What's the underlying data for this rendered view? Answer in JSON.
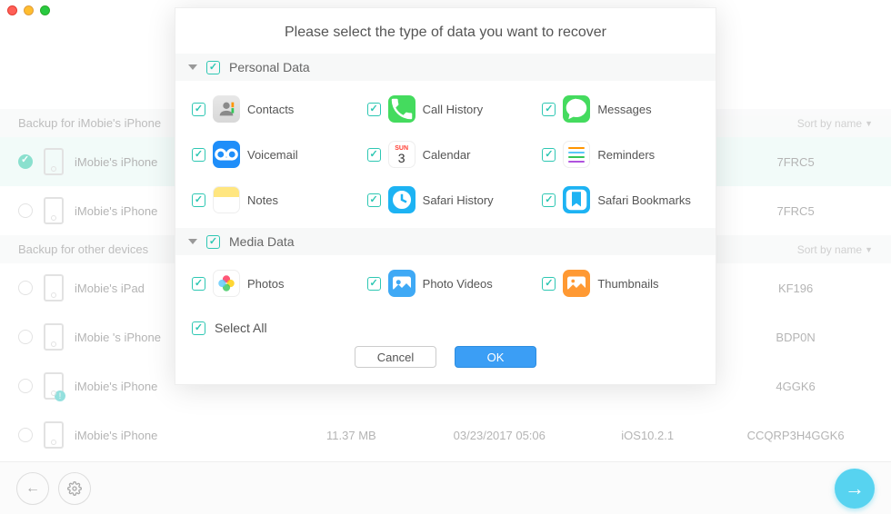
{
  "window": {
    "traffic": [
      "close",
      "minimize",
      "maximize"
    ]
  },
  "sort_label": "Sort by name",
  "sections": [
    {
      "title": "Backup for iMobie's iPhone"
    },
    {
      "title": "Backup for other devices"
    }
  ],
  "rows": [
    {
      "name": "iMobie's iPhone",
      "size": "",
      "date": "",
      "ios": "",
      "id": "7FRC5",
      "selected": true
    },
    {
      "name": "iMobie's iPhone",
      "size": "",
      "date": "",
      "ios": "",
      "id": "7FRC5",
      "selected": false
    },
    {
      "name": "iMobie's iPad",
      "size": "",
      "date": "",
      "ios": "",
      "id": "KF196",
      "selected": false
    },
    {
      "name": "iMobie 's iPhone",
      "size": "",
      "date": "",
      "ios": "",
      "id": "BDP0N",
      "selected": false
    },
    {
      "name": "iMobie's iPhone",
      "size": "",
      "date": "",
      "ios": "",
      "id": "4GGK6",
      "selected": false,
      "warn": true
    },
    {
      "name": "iMobie's iPhone",
      "size": "11.37 MB",
      "date": "03/23/2017 05:06",
      "ios": "iOS10.2.1",
      "id": "CCQRP3H4GGK6",
      "selected": false
    }
  ],
  "modal": {
    "title": "Please select the type of data you want to recover",
    "groups": [
      {
        "label": "Personal Data",
        "items": [
          {
            "label": "Contacts",
            "icon": "contacts"
          },
          {
            "label": "Call History",
            "icon": "call"
          },
          {
            "label": "Messages",
            "icon": "msg"
          },
          {
            "label": "Voicemail",
            "icon": "voicemail"
          },
          {
            "label": "Calendar",
            "icon": "calendar"
          },
          {
            "label": "Reminders",
            "icon": "reminders"
          },
          {
            "label": "Notes",
            "icon": "notes"
          },
          {
            "label": "Safari History",
            "icon": "safari-hist"
          },
          {
            "label": "Safari Bookmarks",
            "icon": "safari-bm"
          }
        ]
      },
      {
        "label": "Media Data",
        "items": [
          {
            "label": "Photos",
            "icon": "photos"
          },
          {
            "label": "Photo Videos",
            "icon": "photovideos"
          },
          {
            "label": "Thumbnails",
            "icon": "thumbnails"
          }
        ]
      }
    ],
    "select_all": "Select All",
    "cancel": "Cancel",
    "ok": "OK"
  }
}
